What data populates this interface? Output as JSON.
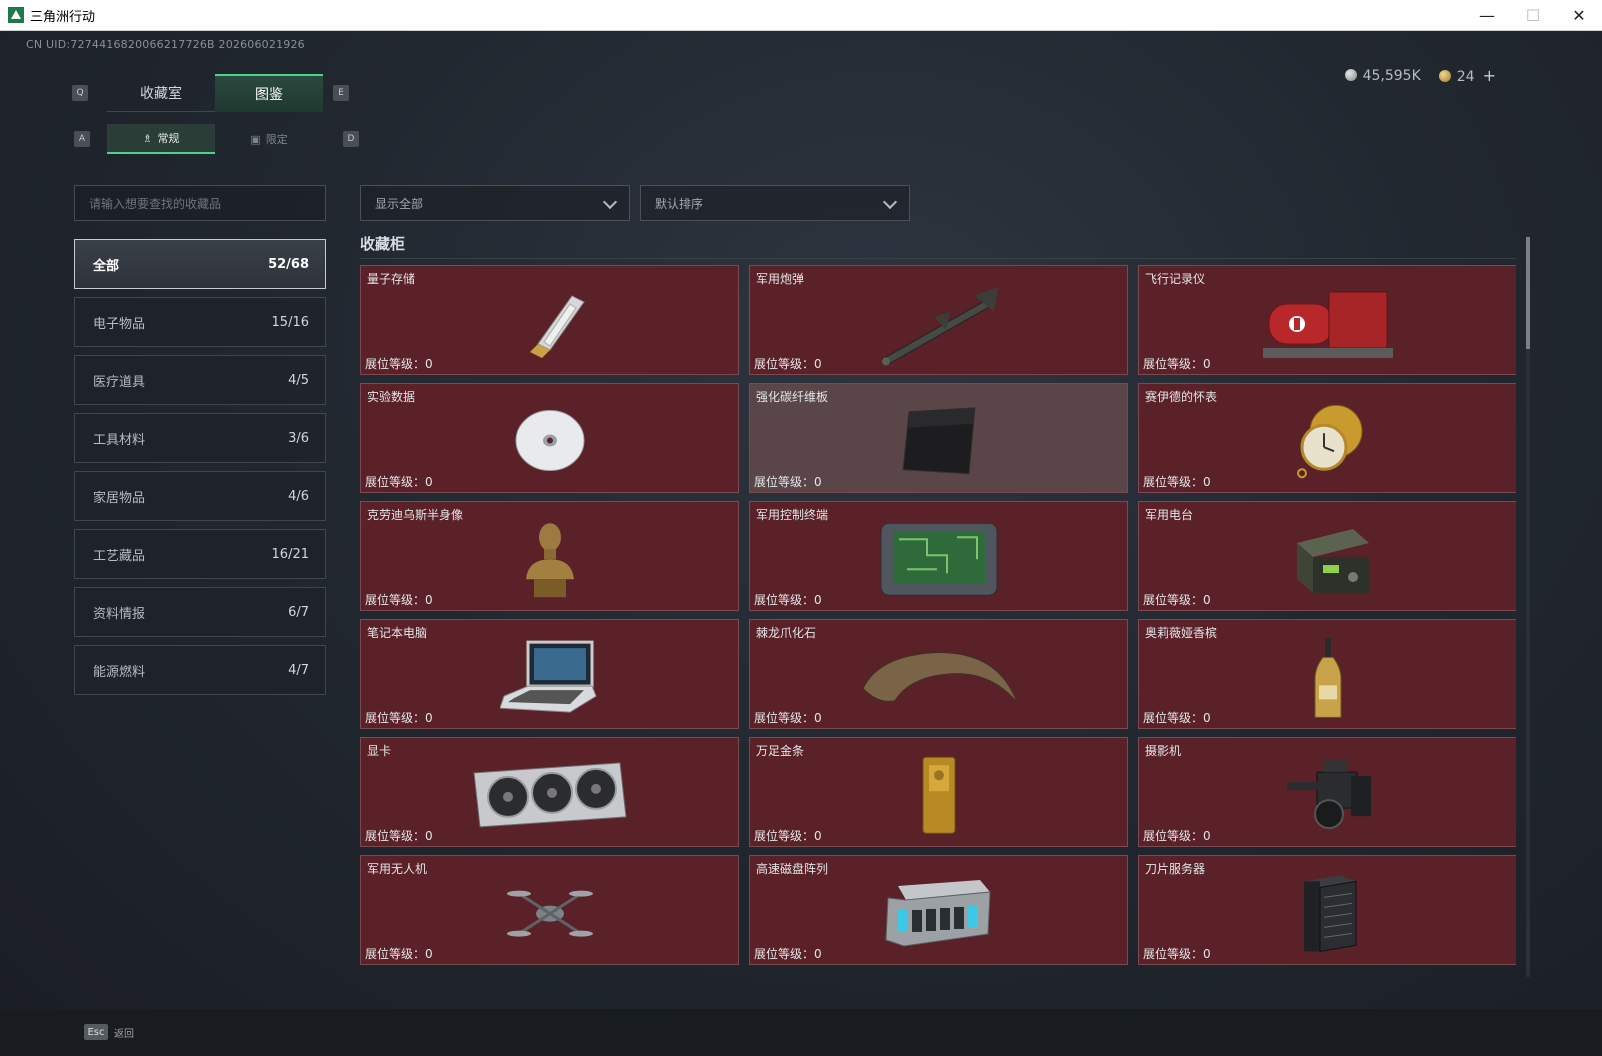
{
  "window": {
    "title": "三角洲行动",
    "controls": [
      "—",
      "☐",
      "✕"
    ]
  },
  "uid": "CN UID:7274416820066217726B 202606021926",
  "currency": {
    "silver": "45,595K",
    "gold": "24",
    "add": "+"
  },
  "keys": {
    "prev_tab": "Q",
    "next_tab": "E",
    "prev_sub": "A",
    "next_sub": "D"
  },
  "tabs": [
    {
      "label": "收藏室"
    },
    {
      "label": "图鉴"
    }
  ],
  "subtabs": [
    {
      "label": "常规"
    },
    {
      "label": "限定"
    }
  ],
  "search": {
    "placeholder": "请输入想要查找的收藏品"
  },
  "filters": {
    "show": "显示全部",
    "sort": "默认排序"
  },
  "categories": [
    {
      "label": "全部",
      "count": "52/68"
    },
    {
      "label": "电子物品",
      "count": "15/16"
    },
    {
      "label": "医疗道具",
      "count": "4/5"
    },
    {
      "label": "工具材料",
      "count": "3/6"
    },
    {
      "label": "家居物品",
      "count": "4/6"
    },
    {
      "label": "工艺藏品",
      "count": "16/21"
    },
    {
      "label": "资料情报",
      "count": "6/7"
    },
    {
      "label": "能源燃料",
      "count": "4/7"
    }
  ],
  "section_title": "收藏柜",
  "items": [
    {
      "name": "量子存储",
      "level": "展位等级：0",
      "icon": "usb-storage-icon"
    },
    {
      "name": "军用炮弹",
      "level": "展位等级：0",
      "icon": "missile-icon"
    },
    {
      "name": "飞行记录仪",
      "level": "展位等级：0",
      "icon": "flight-recorder-icon"
    },
    {
      "name": "实验数据",
      "level": "展位等级：0",
      "icon": "disc-icon"
    },
    {
      "name": "强化碳纤维板",
      "level": "展位等级：0",
      "icon": "carbon-plate-icon"
    },
    {
      "name": "赛伊德的怀表",
      "level": "展位等级：0",
      "icon": "pocket-watch-icon"
    },
    {
      "name": "克劳迪乌斯半身像",
      "level": "展位等级：0",
      "icon": "bust-icon"
    },
    {
      "name": "军用控制终端",
      "level": "展位等级：0",
      "icon": "control-terminal-icon"
    },
    {
      "name": "军用电台",
      "level": "展位等级：0",
      "icon": "radio-icon"
    },
    {
      "name": "笔记本电脑",
      "level": "展位等级：0",
      "icon": "laptop-icon"
    },
    {
      "name": "棘龙爪化石",
      "level": "展位等级：0",
      "icon": "claw-fossil-icon"
    },
    {
      "name": "奥莉薇娅香槟",
      "level": "展位等级：0",
      "icon": "champagne-icon"
    },
    {
      "name": "显卡",
      "level": "展位等级：0",
      "icon": "graphics-card-icon"
    },
    {
      "name": "万足金条",
      "level": "展位等级：0",
      "icon": "gold-bar-icon"
    },
    {
      "name": "摄影机",
      "level": "展位等级：0",
      "icon": "camera-icon"
    },
    {
      "name": "军用无人机",
      "level": "展位等级：0",
      "icon": "drone-icon"
    },
    {
      "name": "高速磁盘阵列",
      "level": "展位等级：0",
      "icon": "disk-array-icon"
    },
    {
      "name": "刀片服务器",
      "level": "展位等级：0",
      "icon": "blade-server-icon"
    }
  ],
  "bottom": {
    "esc": "Esc",
    "back": "返回"
  },
  "colors": {
    "accent": "#4fd18f",
    "card_bg": "#5b2128",
    "card_locked_bg": "#5a4648"
  }
}
